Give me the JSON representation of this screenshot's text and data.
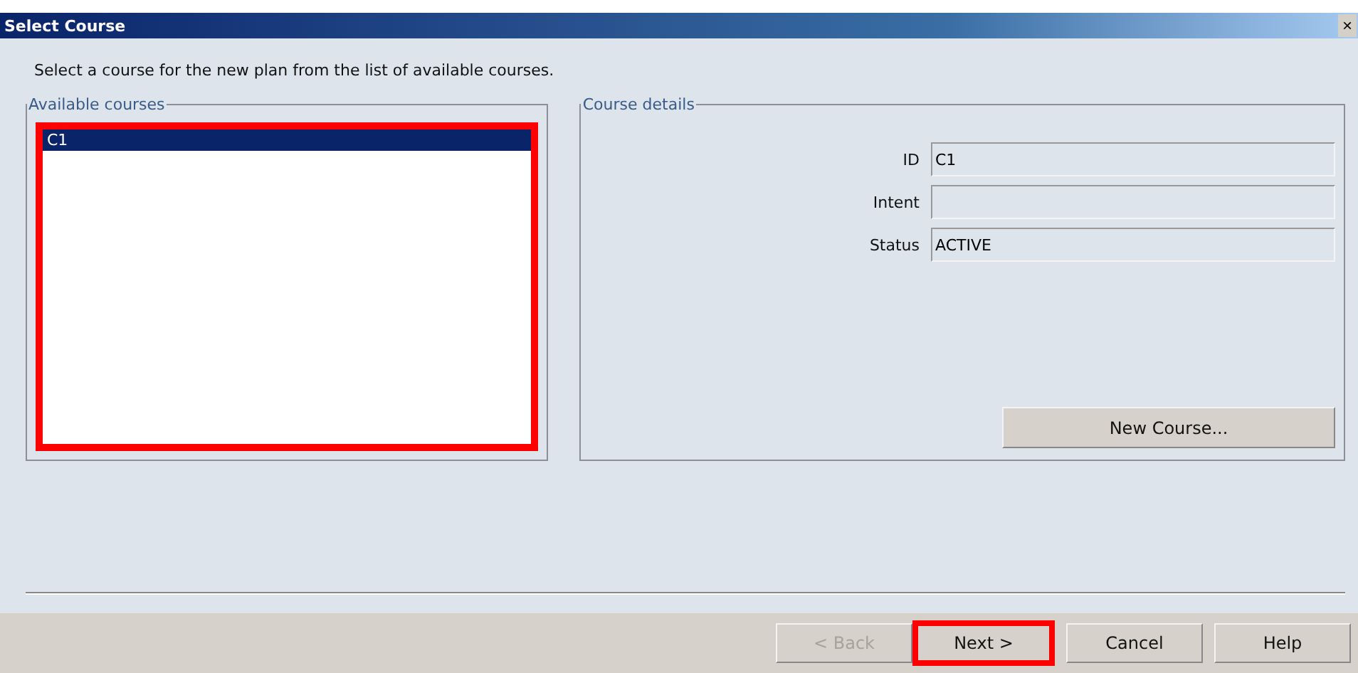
{
  "window": {
    "title": "Select Course",
    "close": "×"
  },
  "instruction": "Select a course for the new plan from the list of available courses.",
  "available_courses": {
    "title": "Available courses",
    "highlighted": true,
    "items": [
      {
        "label": "C1",
        "selected": true
      }
    ]
  },
  "course_details": {
    "title": "Course details",
    "fields": [
      {
        "label": "ID",
        "value": "C1"
      },
      {
        "label": "Intent"
      },
      {
        "label": "Status",
        "value": "ACTIVE"
      }
    ],
    "new_course_button": "New Course..."
  },
  "buttons": [
    {
      "label": "< Back",
      "disabled": true,
      "highlighted": false
    },
    {
      "label": "Next >",
      "disabled": false,
      "highlighted": true
    },
    {
      "label": "Cancel",
      "disabled": false,
      "highlighted": false
    },
    {
      "label": "Help",
      "disabled": false,
      "highlighted": false
    }
  ]
}
